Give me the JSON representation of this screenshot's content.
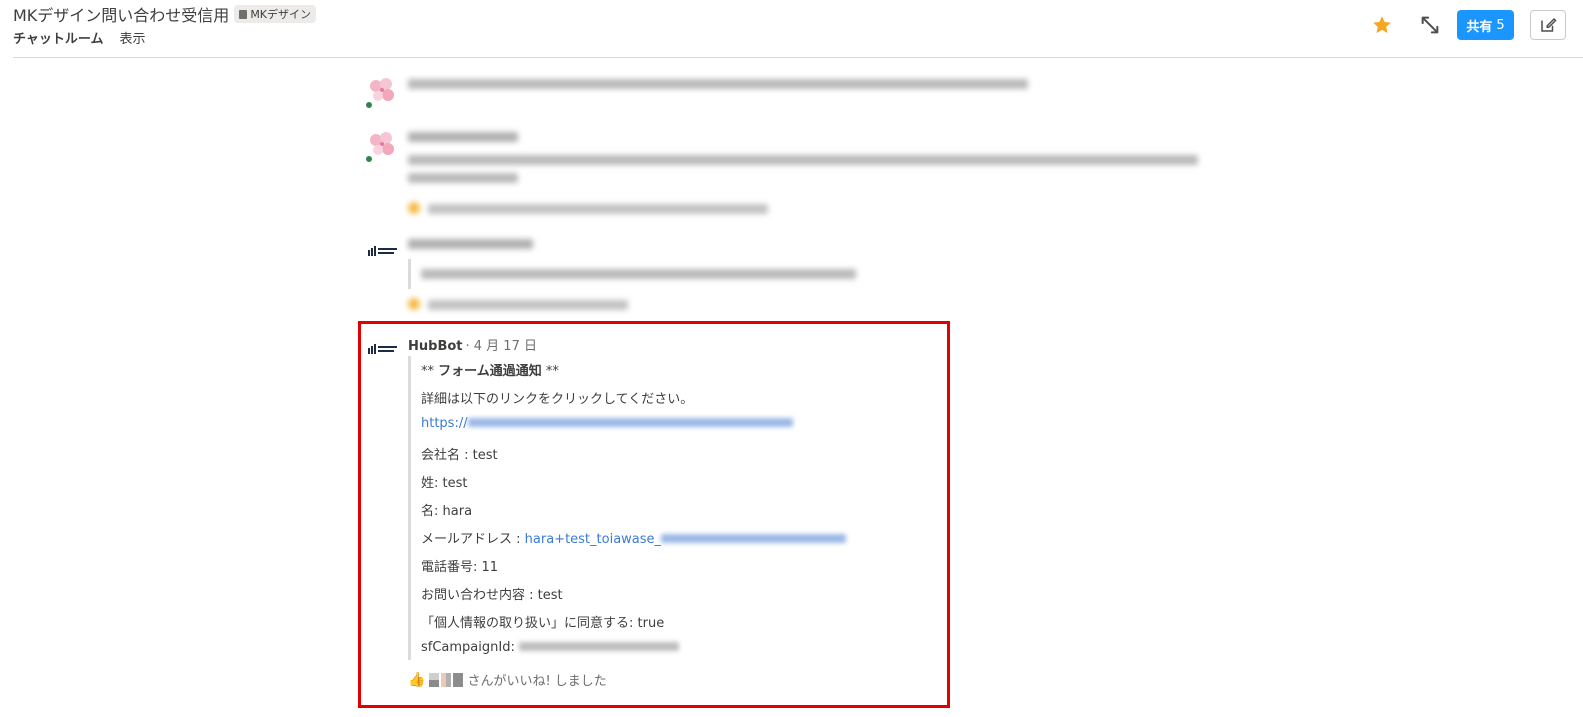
{
  "header": {
    "title": "MKデザイン問い合わせ受信用",
    "group_badge": "MKデザイン",
    "tab_chat": "チャットルーム",
    "tab_view": "表示",
    "share_label": "共有",
    "share_count": "5"
  },
  "icons": {
    "star": "star-icon",
    "expand": "expand-arrows-icon",
    "edit": "edit-note-icon"
  },
  "colors": {
    "accent": "#1b96ff",
    "star": "#f5a623",
    "highlight": "#e30000",
    "link": "#3a7bd5"
  },
  "feed": {
    "bot_name": "HubBot",
    "highlighted_message": {
      "author": "HubBot",
      "date": "· 4 月 17 日",
      "lines": [
        {
          "prefix": "** ",
          "bold": "フォーム通過通知",
          "suffix": " **"
        },
        {
          "text": "詳細は以下のリンクをクリックしてください。"
        },
        {
          "link_prefix": "https://"
        },
        {
          "text": "会社名 : test"
        },
        {
          "text": "姓: test"
        },
        {
          "text": "名: hara"
        },
        {
          "label": "メールアドレス : ",
          "link": "hara+test_toiawase_"
        },
        {
          "text": "電話番号: 11"
        },
        {
          "text": "お問い合わせ内容 : test"
        },
        {
          "text": "「個人情報の取り扱い」に同意する: true"
        },
        {
          "label": "sfCampaignId: "
        }
      ],
      "like_text": "さんがいいね! しました"
    }
  }
}
